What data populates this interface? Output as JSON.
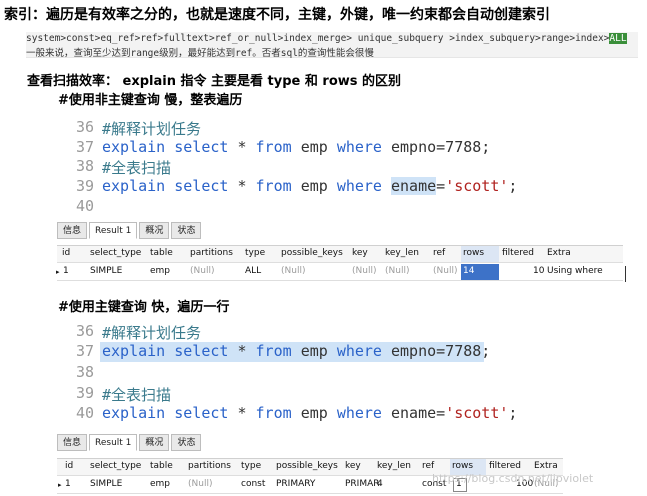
{
  "heading_index": "索引：遍历是有效率之分的，也就是速度不同，主键，外键，唯一约束都会自动创建索引",
  "type_ranking": {
    "line1_before": "system>const>eq_ref>ref>fulltext>ref_or_null>index_merge> unique_subquery >index_subquery>range>index>",
    "line1_highlight": "ALL",
    "line2": "一般来说，查询至少达到range级别，最好能达到ref。否者sql的查询性能会很慢"
  },
  "heading_efficiency": "查看扫描效率：  explain 指令   主要是看 type 和 rows 的区别",
  "section1": {
    "heading": "#使用非主键查询      慢，整表遍历",
    "lines": [
      {
        "num": "36",
        "comment": "#解释计划任务"
      },
      {
        "num": "37",
        "kw1": "explain",
        "kw2": "select",
        "star": "*",
        "kw3": "from",
        "tbl": "emp",
        "kw4": "where",
        "cond": "empno=7788;"
      },
      {
        "num": "38",
        "comment": "#全表扫描"
      },
      {
        "num": "39",
        "kw1": "explain",
        "kw2": "select",
        "star": "*",
        "kw3": "from",
        "tbl": "emp",
        "kw4": "where",
        "col": "ename",
        "eq": "=",
        "str": "'scott'",
        "semi": ";"
      },
      {
        "num": "40"
      }
    ],
    "tabs": [
      "信息",
      "Result 1",
      "概况",
      "状态"
    ],
    "columns": [
      "id",
      "select_type",
      "table",
      "partitions",
      "type",
      "possible_keys",
      "key",
      "key_len",
      "ref",
      "rows",
      "filtered",
      "Extra"
    ],
    "row": {
      "marker": "▸",
      "id": "1",
      "select_type": "SIMPLE",
      "table": "emp",
      "partitions": "(Null)",
      "type": "ALL",
      "possible_keys": "(Null)",
      "key": "(Null)",
      "key_len": "(Null)",
      "ref": "(Null)",
      "rows": "14",
      "filtered": "10",
      "extra": "Using where"
    }
  },
  "section2": {
    "heading": "#使用主键查询       快，遍历一行",
    "lines": [
      {
        "num": "36",
        "comment": "#解释计划任务"
      },
      {
        "num": "37",
        "kw1": "explain",
        "kw2": "select",
        "star": "*",
        "kw3": "from",
        "tbl": "emp",
        "kw4": "where",
        "cond": "empno=7788;"
      },
      {
        "num": "38"
      },
      {
        "num": "39",
        "comment": "#全表扫描"
      },
      {
        "num": "40",
        "kw1": "explain",
        "kw2": "select",
        "star": "*",
        "kw3": "from",
        "tbl": "emp",
        "kw4": "where",
        "col": "ename",
        "eq": "=",
        "str": "'scott'",
        "semi": ";"
      }
    ],
    "tabs": [
      "信息",
      "Result 1",
      "概况",
      "状态"
    ],
    "columns": [
      "id",
      "select_type",
      "table",
      "partitions",
      "type",
      "possible_keys",
      "key",
      "key_len",
      "ref",
      "rows",
      "filtered",
      "Extra"
    ],
    "row": {
      "marker": "▸",
      "id": "1",
      "select_type": "SIMPLE",
      "table": "emp",
      "partitions": "(Null)",
      "type": "const",
      "possible_keys": "PRIMARY",
      "key": "PRIMAR",
      "key_len": "4",
      "ref": "const",
      "rows": "1",
      "filtered": "100",
      "extra": "(Null)"
    }
  },
  "watermark": "https://blog.csdn.net/lipviolet",
  "colors": {
    "keyword": "#2a62c9",
    "comment": "#3a7a8c",
    "string": "#b0221f",
    "selection": "#cfe3f7",
    "row_selected": "#3d72c8"
  }
}
